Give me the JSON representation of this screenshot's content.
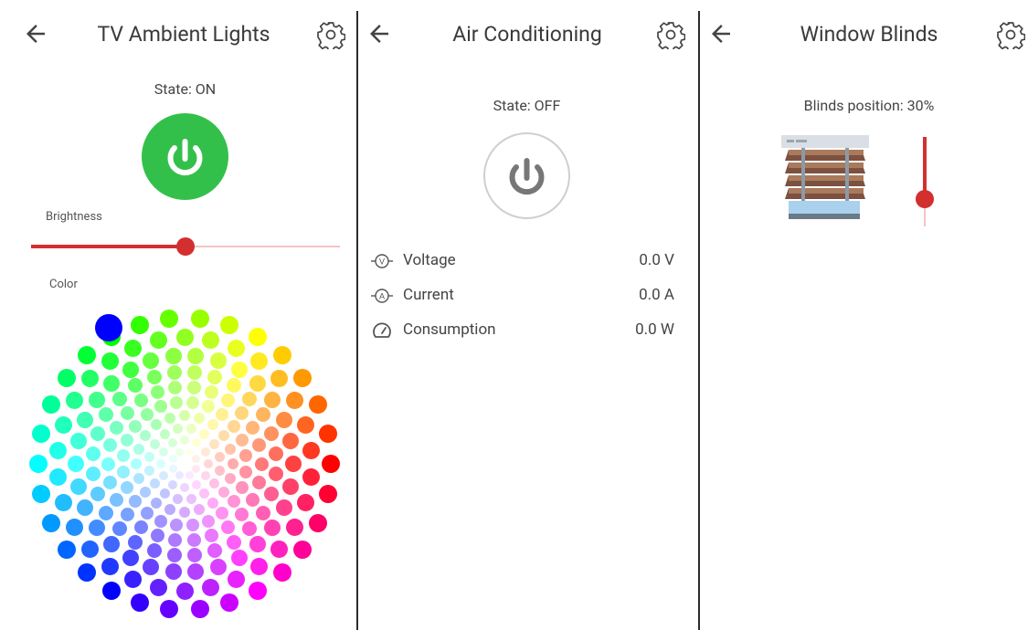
{
  "panels": [
    {
      "title": "TV Ambient Lights",
      "state_text": "State: ON",
      "power_color": "#33c04a",
      "brightness_label": "Brightness",
      "brightness_value": 0.5,
      "slider_color": "#d32f2f",
      "color_label": "Color",
      "selected_color": "#0000ff"
    },
    {
      "title": "Air Conditioning",
      "state_text": "State: OFF",
      "metrics": [
        {
          "icon": "voltage-icon",
          "name": "Voltage",
          "value": "0.0 V"
        },
        {
          "icon": "current-icon",
          "name": "Current",
          "value": "0.0 A"
        },
        {
          "icon": "gauge-icon",
          "name": "Consumption",
          "value": "0.0 W"
        }
      ]
    },
    {
      "title": "Window Blinds",
      "position_text": "Blinds position: 30%",
      "position_value": 0.3,
      "slider_color": "#d32f2f"
    }
  ],
  "icons": {
    "back": "arrow-left-icon",
    "settings": "gear-icon",
    "power": "power-icon",
    "blinds": "window-blinds-icon"
  }
}
